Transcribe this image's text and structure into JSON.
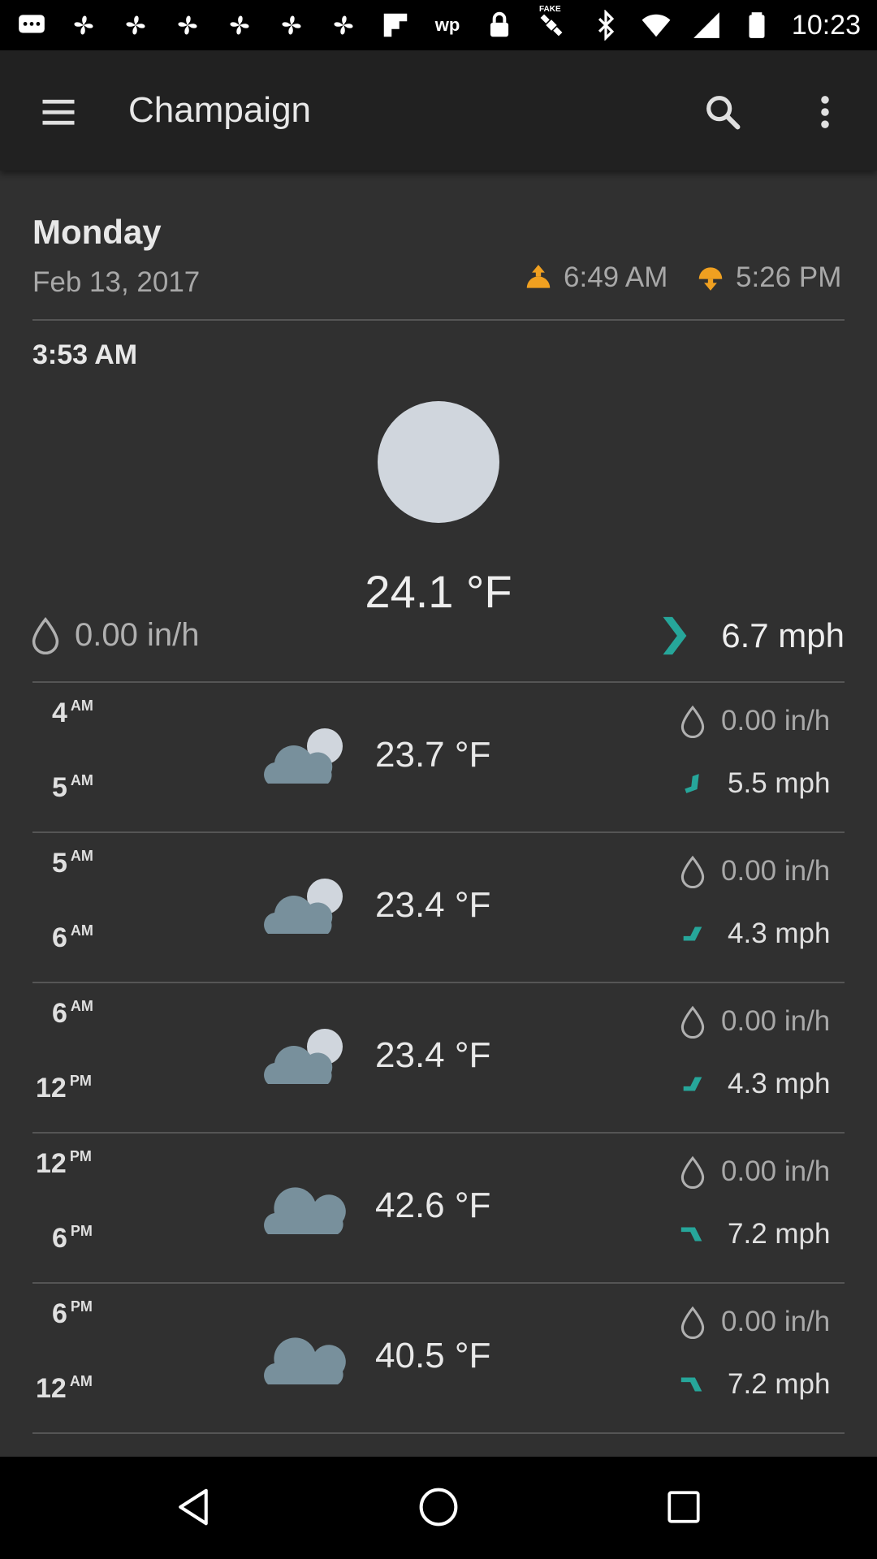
{
  "status_bar": {
    "time": "10:23",
    "fake_badge": "FAKE",
    "wp_badge": "wp",
    "left_icons": [
      "message-icon",
      "fan-icon",
      "fan-icon",
      "fan-icon",
      "fan-icon",
      "fan-icon",
      "fan-icon",
      "flipboard-icon",
      "wp-icon",
      "lock-icon",
      "fake-gps-icon"
    ],
    "right_icons": [
      "bluetooth-icon",
      "wifi-icon",
      "signal-icon",
      "battery-icon"
    ]
  },
  "app_bar": {
    "title": "Champaign",
    "icons": [
      "menu-icon",
      "search-icon",
      "more-vert-icon"
    ]
  },
  "day": {
    "name": "Monday",
    "date": "Feb 13, 2017",
    "sunrise": "6:49 AM",
    "sunset": "5:26 PM"
  },
  "current": {
    "time": "3:53 AM",
    "temperature": "24.1 °F",
    "precipitation": "0.00 in/h",
    "wind": "6.7 mph",
    "icon": "moon-icon"
  },
  "forecast": [
    {
      "start": "4",
      "start_period": "AM",
      "end": "5",
      "end_period": "AM",
      "temperature": "23.7 °F",
      "precipitation": "0.00 in/h",
      "wind": "5.5 mph",
      "icon": "partly-cloudy-night-icon"
    },
    {
      "start": "5",
      "start_period": "AM",
      "end": "6",
      "end_period": "AM",
      "temperature": "23.4 °F",
      "precipitation": "0.00 in/h",
      "wind": "4.3 mph",
      "icon": "partly-cloudy-night-icon"
    },
    {
      "start": "6",
      "start_period": "AM",
      "end": "12",
      "end_period": "PM",
      "temperature": "23.4 °F",
      "precipitation": "0.00 in/h",
      "wind": "4.3 mph",
      "icon": "partly-cloudy-night-icon"
    },
    {
      "start": "12",
      "start_period": "PM",
      "end": "6",
      "end_period": "PM",
      "temperature": "42.6 °F",
      "precipitation": "0.00 in/h",
      "wind": "7.2 mph",
      "icon": "cloud-icon"
    },
    {
      "start": "6",
      "start_period": "PM",
      "end": "12",
      "end_period": "AM",
      "temperature": "40.5 °F",
      "precipitation": "0.00 in/h",
      "wind": "7.2 mph",
      "icon": "cloud-icon"
    }
  ],
  "colors": {
    "background": "#303030",
    "app_bar": "#212121",
    "sun_icon": "#f0a020",
    "wind_arrow": "#26a69a",
    "cloud": "#78909c",
    "moon": "#d0d6dd"
  },
  "nav_bar": {
    "icons": [
      "back-icon",
      "home-icon",
      "recents-icon"
    ]
  }
}
